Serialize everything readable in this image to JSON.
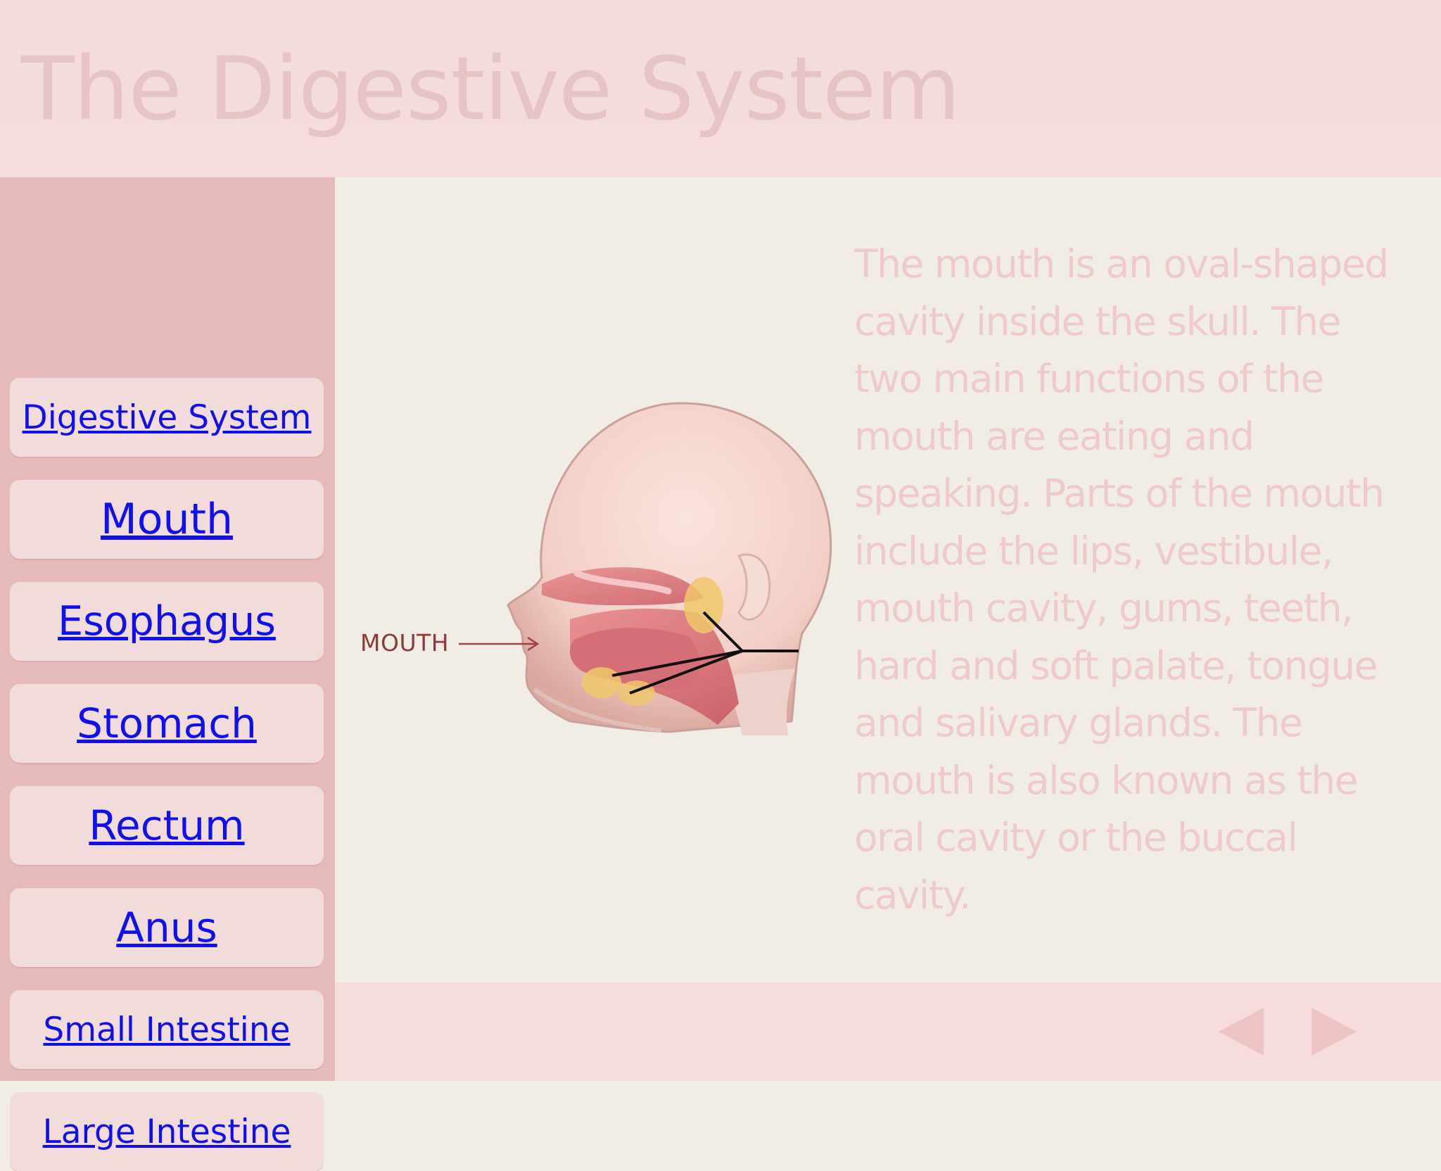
{
  "header": {
    "title": "The Digestive System"
  },
  "sidebar": {
    "items": [
      {
        "label": "Digestive System"
      },
      {
        "label": "Mouth"
      },
      {
        "label": "Esophagus"
      },
      {
        "label": "Stomach"
      },
      {
        "label": "Rectum"
      },
      {
        "label": "Anus"
      },
      {
        "label": "Small Intestine"
      },
      {
        "label": "Large Intestine"
      }
    ]
  },
  "main": {
    "figure_label": "MOUTH",
    "description": "The mouth is an oval-shaped cavity inside the skull. The two main functions of the mouth are eating and speaking. Parts of the mouth include the lips, vestibule, mouth cavity, gums, teeth, hard and soft palate, tongue and salivary glands. The mouth is also known as the oral cavity or the buccal cavity."
  },
  "footer": {
    "prev_icon": "triangle-left-icon",
    "next_icon": "triangle-right-icon"
  },
  "colors": {
    "header_bg": "#f7dcdd",
    "sidebar_bg": "#e6babb",
    "button_bg": "#f2dbdb",
    "link": "#1010ee",
    "title_text": "#e7c4c4",
    "description_text": "#eecacb",
    "figure_label": "#8b3a3a"
  }
}
